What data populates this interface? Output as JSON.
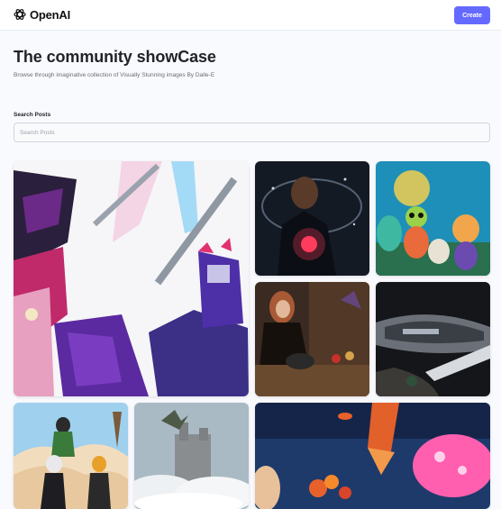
{
  "header": {
    "logo_text": "OpenAI",
    "create_label": "Create",
    "accent_color": "#6469ff"
  },
  "hero": {
    "title": "The community showCase",
    "subtitle": "Browse through imaginative collection of Visually Stunning images By Dalle-E"
  },
  "search": {
    "label": "Search Posts",
    "placeholder": "Search Posts",
    "value": ""
  },
  "gallery": {
    "items": [
      {
        "subject": "anime swordfighters clashing"
      },
      {
        "subject": "person with glowing orb in hand"
      },
      {
        "subject": "colorful cartoon animals party"
      },
      {
        "subject": "woman stirring a cauldron"
      },
      {
        "subject": "sci-fi spaceship"
      },
      {
        "subject": "anime group on rocky mountain"
      },
      {
        "subject": "dragon over castle in clouds"
      },
      {
        "subject": "underwater coral and pink jellyfish"
      }
    ]
  }
}
